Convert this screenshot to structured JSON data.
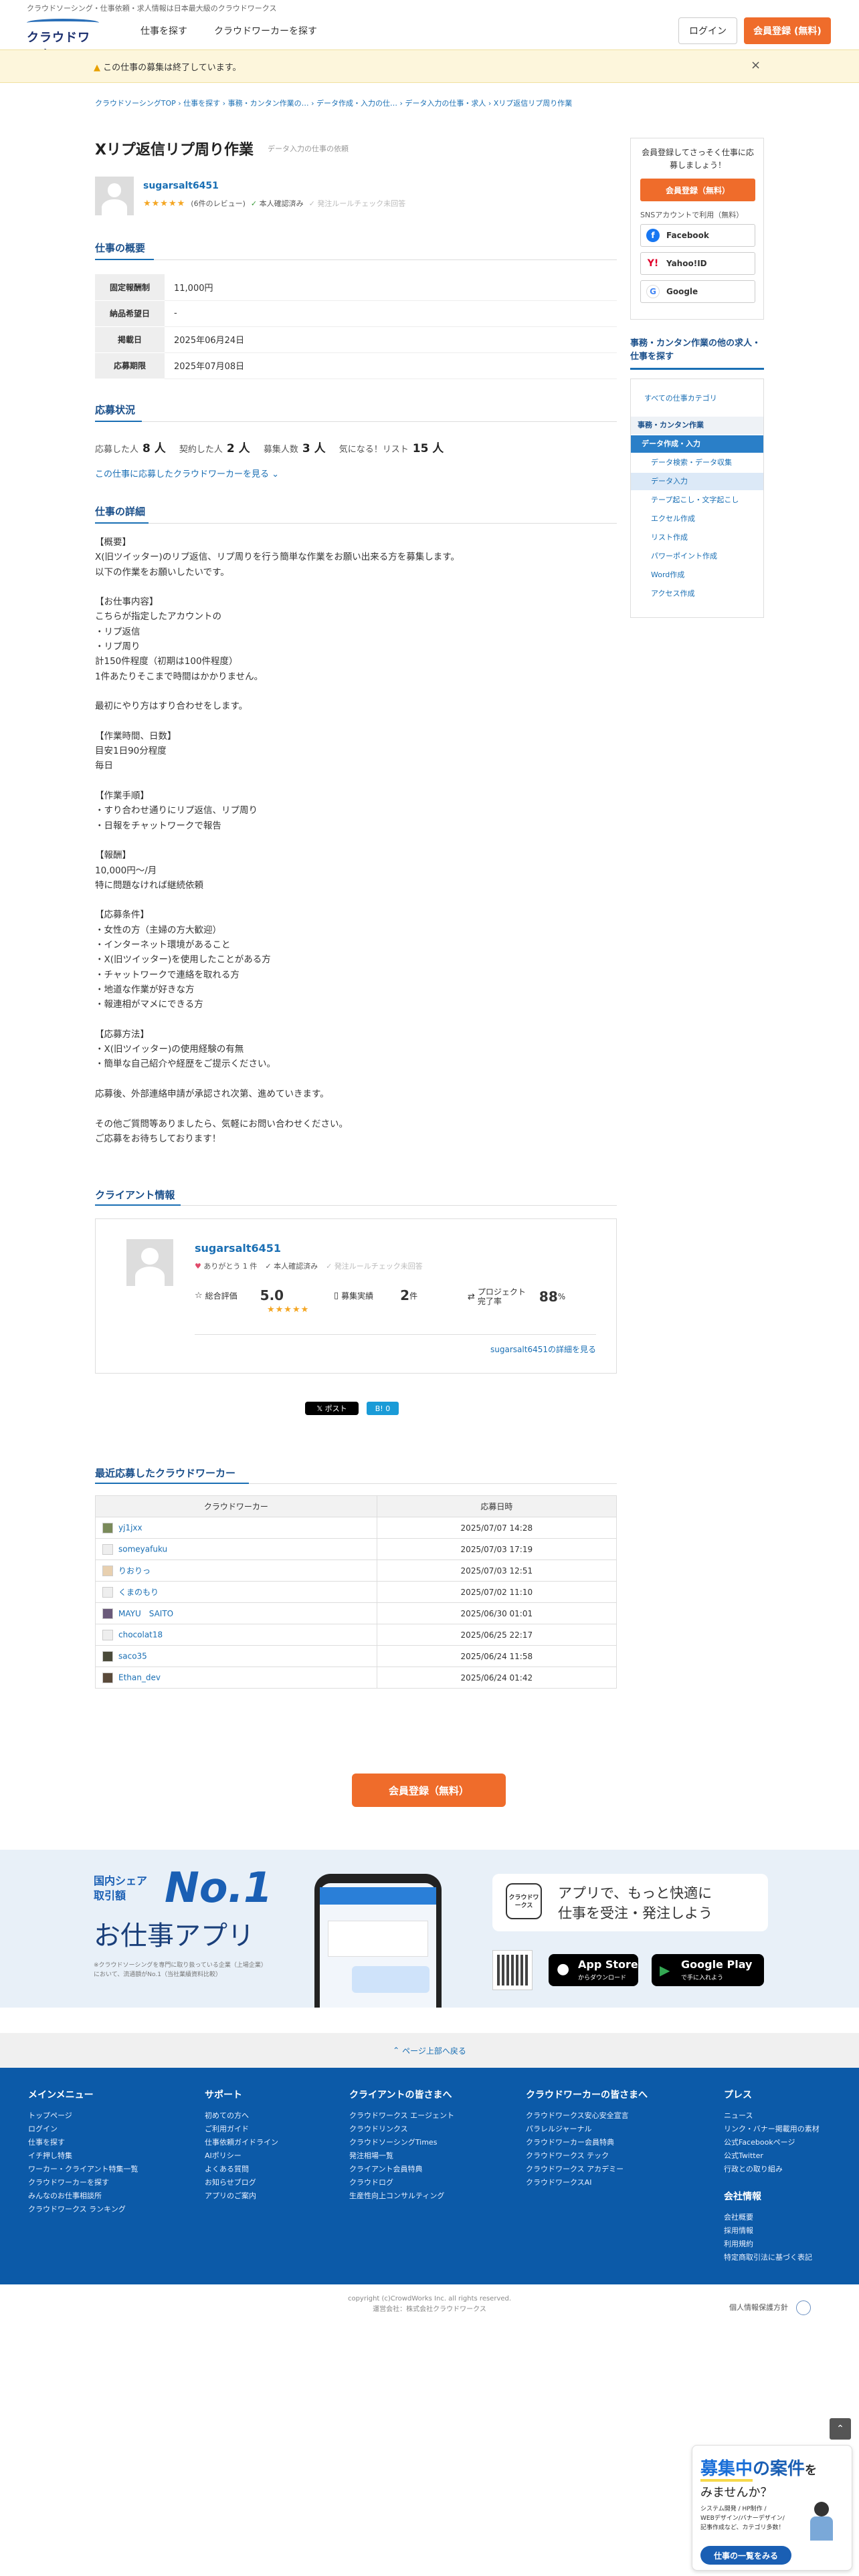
{
  "header": {
    "tagline": "クラウドソーシング・仕事依頼・求人情報は日本最大級のクラウドワークス",
    "logo_text": "クラウドワークス",
    "nav": [
      "仕事を探す",
      "クラウドワーカーを探す"
    ],
    "login": "ログイン",
    "register": "会員登録 (無料)"
  },
  "notice": {
    "text": "この仕事の募集は終了しています。",
    "close": "×"
  },
  "breadcrumb": "クラウドソーシングTOP › 仕事を探す › 事務・カンタン作業の… › データ作成・入力の仕… › データ入力の仕事・求人 › Xリプ返信リプ周り作業",
  "job": {
    "title": "Xリプ返信リプ周り作業",
    "category": "データ入力の仕事の依頼",
    "client_name": "sugarsalt6451",
    "stars": "★★★★★",
    "reviews": "(6件のレビュー)",
    "verified": "本人確認済み",
    "rule_check": "発注ルールチェック未回答"
  },
  "summary": {
    "title": "仕事の概要",
    "rows": [
      {
        "k": "固定報酬制",
        "v": "11,000円"
      },
      {
        "k": "納品希望日",
        "v": "-"
      },
      {
        "k": "掲載日",
        "v": "2025年06月24日"
      },
      {
        "k": "応募期限",
        "v": "2025年07月08日"
      }
    ]
  },
  "status": {
    "title": "応募状況",
    "applicants_label": "応募した人",
    "applicants": "8 人",
    "contracted_label": "契約した人",
    "contracted": "2 人",
    "recruit_label": "募集人数",
    "recruit": "3 人",
    "watch_label": "気になる！リスト",
    "watch": "15 人",
    "link": "この仕事に応募したクラウドワーカーを見る"
  },
  "detail": {
    "title": "仕事の詳細",
    "body": "【概要】\nX(旧ツイッター)のリプ返信、リプ周りを行う簡単な作業をお願い出来る方を募集します。\n以下の作業をお願いしたいです。\n\n【お仕事内容】\nこちらが指定したアカウントの\n・リプ返信\n・リプ周り\n計150件程度（初期は100件程度）\n1件あたりそこまで時間はかかりません。\n\n最初にやり方はすり合わせをします。\n\n【作業時間、日数】\n目安1日90分程度\n毎日\n\n【作業手順】\n・すり合わせ通りにリプ返信、リプ周り\n・日報をチャットワークで報告\n\n【報酬】\n10,000円〜/月\n特に問題なければ継続依頼\n\n【応募条件】\n・女性の方（主婦の方大歓迎）\n・インターネット環境があること\n・X(旧ツイッター)を使用したことがある方\n・チャットワークで連絡を取れる方\n・地道な作業が好きな方\n・報連相がマメにできる方\n\n【応募方法】\n・X(旧ツイッター)の使用経験の有無\n・簡単な自己紹介や経歴をご提示ください。\n\n応募後、外部連絡申請が承認され次第、進めていきます。\n\nその他ご質問等ありましたら、気軽にお問い合わせください。\nご応募をお待ちしております！"
  },
  "client": {
    "title": "クライアント情報",
    "name": "sugarsalt6451",
    "thanks": "ありがとう 1 件",
    "verified": "本人確認済み",
    "rule_check": "発注ルールチェック未回答",
    "rating_label": "総合評価",
    "rating": "5.0",
    "stars": "★★★★★",
    "record_label": "募集実績",
    "record": "2",
    "record_unit": "件",
    "complete_label": "プロジェクト完了率",
    "complete": "88",
    "complete_unit": "%",
    "link": "sugarsalt6451の詳細を見る"
  },
  "share": {
    "post": "𝕏 ポスト",
    "hatena": "B! 0"
  },
  "recent": {
    "title": "最近応募したクラウドワーカー",
    "col_worker": "クラウドワーカー",
    "col_date": "応募日時",
    "rows": [
      {
        "name": "yj1jxx",
        "date": "2025/07/07 14:28"
      },
      {
        "name": "someyafuku",
        "date": "2025/07/03 17:19"
      },
      {
        "name": "りおりっ",
        "date": "2025/07/03 12:51"
      },
      {
        "name": "くまのもり",
        "date": "2025/07/02 11:10"
      },
      {
        "name": "MAYU　SAITO",
        "date": "2025/06/30 01:01"
      },
      {
        "name": "chocolat18",
        "date": "2025/06/25 22:17"
      },
      {
        "name": "saco35",
        "date": "2025/06/24 11:58"
      },
      {
        "name": "Ethan_dev",
        "date": "2025/06/24 01:42"
      }
    ]
  },
  "big_register": "会員登録（無料）",
  "sidebar": {
    "reg_msg": "会員登録してさっそく仕事に応募しましょう！",
    "reg_btn": "会員登録（無料）",
    "sns_label": "SNSアカウントで利用（無料）",
    "facebook": "Facebook",
    "yahoo": "Yahoo!ID",
    "google": "Google",
    "cat_title": "事務・カンタン作業の他の求人・仕事を探す",
    "cat_items": [
      "すべての仕事カテゴリ",
      "事務・カンタン作業",
      "データ作成・入力",
      "データ検索・データ収集",
      "データ入力",
      "テープ起こし・文字起こし",
      "エクセル作成",
      "リスト作成",
      "パワーポイント作成",
      "Word作成",
      "アクセス作成"
    ]
  },
  "app_banner": {
    "share": "国内シェア\n取引額",
    "no1": "No.1",
    "app": "お仕事アプリ",
    "note": "※クラウドソーシングを専門に取り扱っている企業（上場企業）において、流通額がNo.1（当社業績資料比較）",
    "headline": "アプリで、もっと快適に\n仕事を受注・発注しよう",
    "appstore": "App Store",
    "appstore_sub": "からダウンロード",
    "googleplay": "Google Play",
    "googleplay_sub": "で手に入れよう",
    "badge": "クラウドワークス"
  },
  "pagetop": "ページ上部へ戻る",
  "footer": {
    "cols": [
      {
        "h": "メインメニュー",
        "links": [
          "トップページ",
          "ログイン",
          "仕事を探す",
          "イチ押し特集",
          "ワーカー・クライアント特集一覧",
          "クラウドワーカーを探す",
          "みんなのお仕事相談所",
          "クラウドワークス ランキング"
        ]
      },
      {
        "h": "サポート",
        "links": [
          "初めての方へ",
          "ご利用ガイド",
          "仕事依頼ガイドライン",
          "AIポリシー",
          "よくある質問",
          "お知らせブログ",
          "アプリのご案内"
        ]
      },
      {
        "h": "クライアントの皆さまへ",
        "links": [
          "クラウドワークス エージェント",
          "クラウドリンクス",
          "クラウドソーシングTimes",
          "発注相場一覧",
          "クライアント会員特典",
          "クラウドログ",
          "生産性向上コンサルティング"
        ]
      },
      {
        "h": "クラウドワーカーの皆さまへ",
        "links": [
          "クラウドワークス安心安全宣言",
          "パラレルジャーナル",
          "クラウドワーカー会員特典",
          "クラウドワークス テック",
          "クラウドワークス アカデミー",
          "クラウドワークスAI"
        ]
      },
      {
        "h": "プレス",
        "links": [
          "ニュース",
          "リンク・バナー掲載用の素材",
          "公式Facebookページ",
          "公式Twitter",
          "行政との取り組み"
        ]
      },
      {
        "h": "会社情報",
        "links": [
          "会社概要",
          "採用情報",
          "利用規約",
          "特定商取引法に基づく表記"
        ]
      }
    ]
  },
  "copyright": "copyright (c)CrowdWorks Inc. all rights reserved.",
  "operator": "運営会社：株式会社クラウドワークス",
  "privacy": "個人情報保護方針",
  "float_ad": {
    "title1": "募集中",
    "title2": "の案件",
    "title3": "を",
    "title4": "みませんか？",
    "sub": "システム開発 / HP制作 /\nWEBデザイン/バナーデザイン/\n記事作成など、カテゴリ多数！",
    "btn": "仕事の一覧をみる"
  }
}
